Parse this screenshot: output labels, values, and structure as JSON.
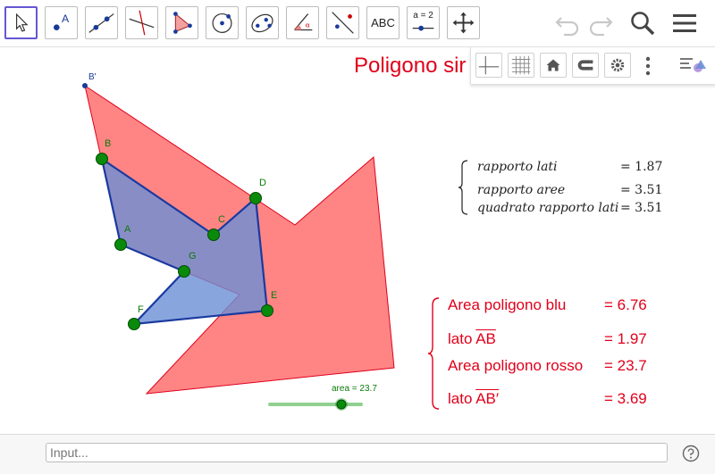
{
  "toolbar": {
    "tools": [
      "move-tool",
      "point-tool",
      "line-tool",
      "perpendicular-line-tool",
      "polygon-tool",
      "circle-tool",
      "conic-tool",
      "angle-tool",
      "reflect-tool",
      "text-tool",
      "slider-tool",
      "move-graphics-view-tool"
    ],
    "text_tool_label": "ABC",
    "slider_tool_label": "a = 2"
  },
  "title": "Poligono sir",
  "points": {
    "B_prime": "B'",
    "B": "B",
    "A": "A",
    "C": "C",
    "D": "D",
    "G": "G",
    "E": "E",
    "F": "F"
  },
  "ratios": [
    {
      "label": "rapporto lati",
      "value": "= 1.87"
    },
    {
      "label": "rapporto aree",
      "value": "= 3.51"
    },
    {
      "label": "quadrato rapporto lati",
      "value": "= 3.51"
    }
  ],
  "info": {
    "area_blue_label": "Area poligono blu",
    "area_blue_value": "= 6.76",
    "side_label": "lato",
    "side_ab": "AB",
    "side_ab_value": "= 1.97",
    "area_red_label": "Area poligono rosso",
    "area_red_value": "= 23.7",
    "side_abp": "AB′",
    "side_abp_value": "= 3.69"
  },
  "slider": {
    "label": "area = 23.7",
    "value": 23.7,
    "fraction": 0.8
  },
  "input": {
    "placeholder": "Input..."
  },
  "colors": {
    "red_polygon": "#ff7070",
    "blue_polygon": "#6b8ed6",
    "point_green": "#0a8a0a",
    "text_red": "#e0001a",
    "active_tool": "#6557d2"
  }
}
